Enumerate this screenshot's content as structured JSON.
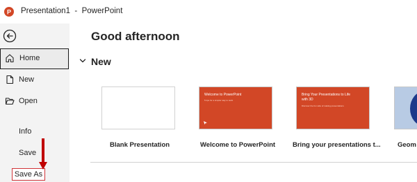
{
  "titlebar": {
    "title": "Presentation1  -  PowerPoint",
    "logo_icon": "powerpoint-logo-icon",
    "brand_color": "#d24726"
  },
  "sidebar": {
    "back_icon": "back-arrow-icon",
    "items": [
      {
        "label": "Home",
        "icon": "home-icon",
        "selected": true
      },
      {
        "label": "New",
        "icon": "new-document-icon"
      },
      {
        "label": "Open",
        "icon": "folder-open-icon"
      },
      {
        "label": "Info"
      },
      {
        "label": "Save"
      },
      {
        "label": "Save As",
        "highlighted": true
      }
    ],
    "annotation_color": "#c00000"
  },
  "main": {
    "greeting": "Good afternoon",
    "new_section": {
      "heading": "New",
      "toggle_icon": "chevron-down-icon",
      "templates": [
        {
          "label": "Blank Presentation"
        },
        {
          "label": "Welcome to PowerPoint",
          "thumb_title": "Welcome to PowerPoint",
          "thumb_sub": "5 tips for a simpler way to work"
        },
        {
          "label": "Bring your presentations t...",
          "thumb_title": "Bring Your Presentations to Life with 3D",
          "thumb_sub": "Discover the fun side of making presentations"
        },
        {
          "label": "Geom"
        }
      ]
    }
  }
}
